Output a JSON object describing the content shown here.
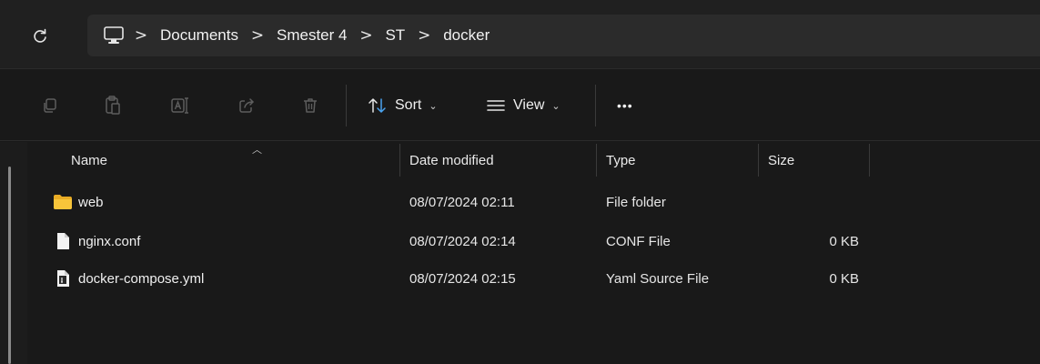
{
  "address_bar": {
    "breadcrumbs": [
      "Documents",
      "Smester 4",
      "ST",
      "docker"
    ],
    "separator": ">"
  },
  "command_bar": {
    "sort_label": "Sort",
    "view_label": "View",
    "more_label": "•••"
  },
  "file_list": {
    "columns": {
      "name": "Name",
      "date": "Date modified",
      "type": "Type",
      "size": "Size"
    },
    "rows": [
      {
        "name": "web",
        "date": "08/07/2024 02:11",
        "type": "File folder",
        "size": "",
        "icon": "folder-icon"
      },
      {
        "name": "nginx.conf",
        "date": "08/07/2024 02:14",
        "type": "CONF File",
        "size": "0 KB",
        "icon": "file-icon"
      },
      {
        "name": "docker-compose.yml",
        "date": "08/07/2024 02:15",
        "type": "Yaml Source File",
        "size": "0 KB",
        "icon": "yaml-file-icon"
      }
    ]
  },
  "colors": {
    "background": "#191919",
    "address_bg": "#2b2b2b",
    "folder": "#f8c53a"
  }
}
